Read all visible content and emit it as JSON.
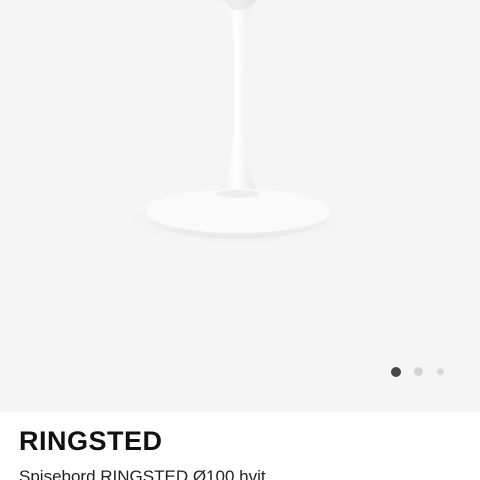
{
  "gallery": {
    "image_alt": "Spisebord RINGSTED Ø100 hvit",
    "image_count": 3,
    "active_index": 1,
    "dot_active_color": "#484848",
    "dot_inactive_color": "#d3d3d3",
    "background_color": "#f5f5f5"
  },
  "product": {
    "brand": "RINGSTED",
    "description": "Spisebord RINGSTED Ø100 hvit"
  }
}
